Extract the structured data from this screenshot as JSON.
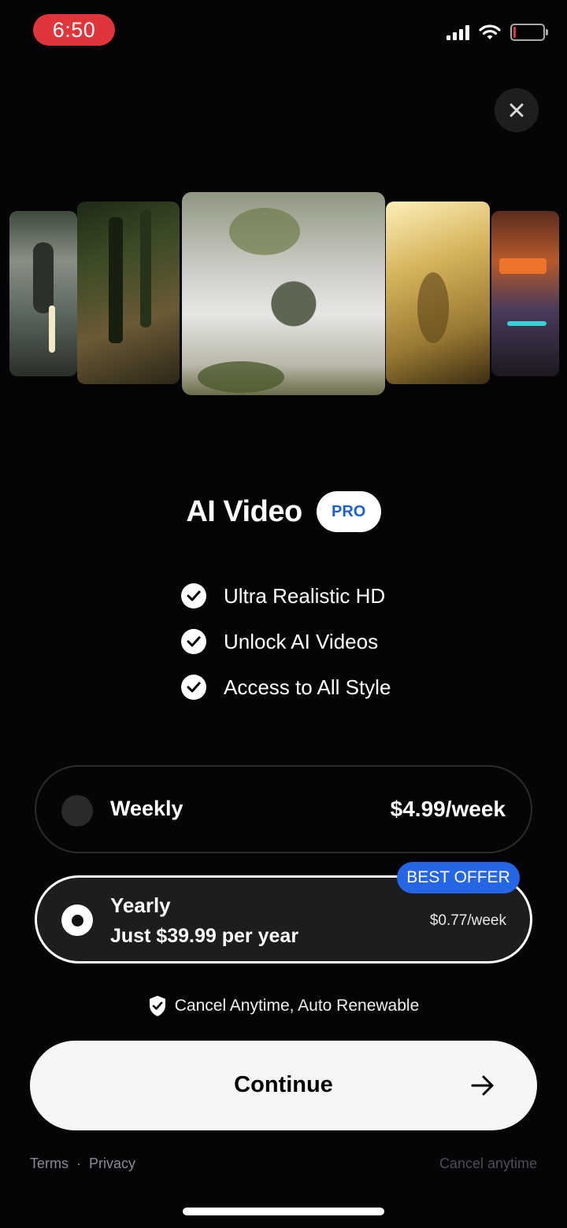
{
  "status_bar": {
    "time": "6:50"
  },
  "paywall": {
    "title": "AI Video",
    "badge": "PRO",
    "features": [
      "Ultra Realistic HD",
      "Unlock AI Videos",
      "Access to All Style"
    ],
    "plans": {
      "weekly": {
        "name": "Weekly",
        "price": "$4.99/week",
        "selected": false
      },
      "yearly": {
        "name": "Yearly",
        "subtitle": "Just $39.99 per year",
        "rate": "$0.77/week",
        "badge": "BEST OFFER",
        "selected": true
      }
    },
    "cancel_note": "Cancel Anytime, Auto Renewable",
    "continue_label": "Continue"
  },
  "footer": {
    "terms": "Terms",
    "separator": "·",
    "privacy": "Privacy",
    "cancel": "Cancel anytime"
  },
  "colors": {
    "accent": "#2466e6",
    "background": "#050507",
    "recording": "#e0353b"
  }
}
